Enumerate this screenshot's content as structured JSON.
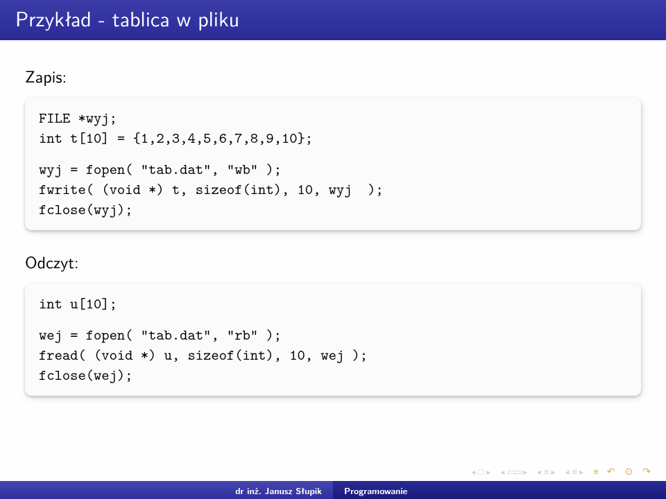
{
  "title": "Przykład - tablica w pliku",
  "sections": {
    "zapis_label": "Zapis:",
    "odczyt_label": "Odczyt:"
  },
  "code": {
    "zapis": {
      "l1": "FILE *wyj;",
      "l2": "int t[10] = {1,2,3,4,5,6,7,8,9,10};",
      "l3": "wyj = fopen( \"tab.dat\", \"wb\" );",
      "l4": "fwrite( (void *) t, sizeof(int), 10, wyj  );",
      "l5": "fclose(wyj);"
    },
    "odczyt": {
      "l1": "int u[10];",
      "l2": "wej = fopen( \"tab.dat\", \"rb\" );",
      "l3": "fread( (void *) u, sizeof(int), 10, wej );",
      "l4": "fclose(wej);"
    }
  },
  "footer": {
    "author": "dr inż. Janusz Słupik",
    "topic": "Programowanie"
  }
}
